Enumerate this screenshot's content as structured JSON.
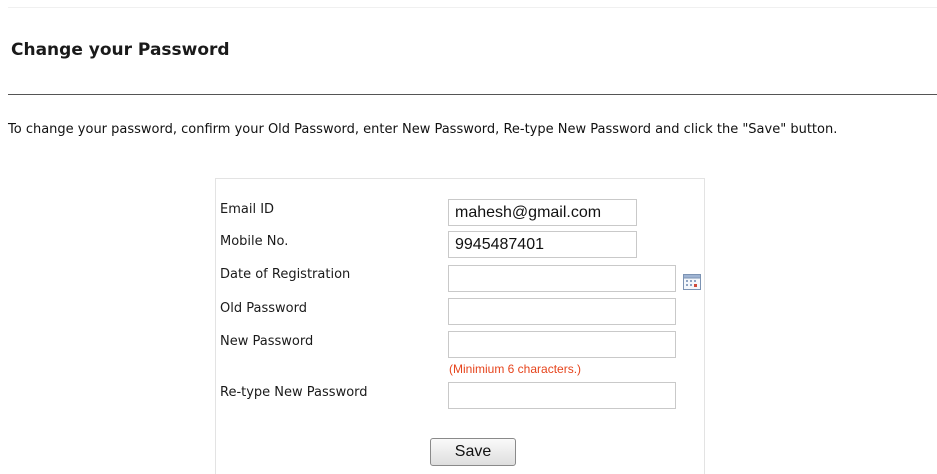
{
  "page": {
    "title": "Change your Password",
    "instructions": "To change your password, confirm your Old Password, enter New Password, Re-type New Password and click the \"Save\" button."
  },
  "form": {
    "email": {
      "label": "Email ID",
      "value": "mahesh@gmail.com"
    },
    "mobile": {
      "label": "Mobile No.",
      "value": "9945487401"
    },
    "registration_date": {
      "label": "Date of Registration",
      "value": "",
      "icon": "calendar-icon"
    },
    "old_password": {
      "label": "Old Password",
      "value": ""
    },
    "new_password": {
      "label": "New Password",
      "value": "",
      "hint": "(Minimium 6 characters.)"
    },
    "retype_password": {
      "label": "Re-type New Password",
      "value": ""
    },
    "save_label": "Save"
  },
  "colors": {
    "hint": "#e6441c",
    "divider": "#555555",
    "panel_border": "#e3e3e3"
  }
}
